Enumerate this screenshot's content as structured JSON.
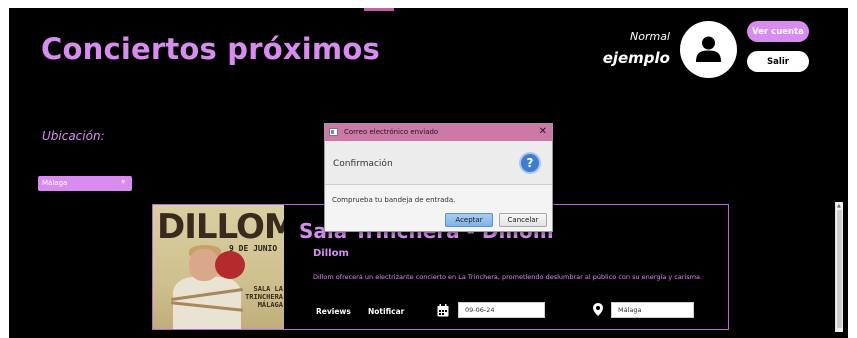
{
  "header": {
    "title": "Conciertos próximos",
    "user_role": "Normal",
    "user_name": "ejemplo",
    "account_button": "Ver cuenta",
    "logout_button": "Salir"
  },
  "filters": {
    "location_label": "Ubicación:",
    "location_selected": "Málaga"
  },
  "event": {
    "title": "Sala Trinchera - Dillom",
    "artist": "Dillom",
    "description": "Dillom ofrecerá un electrizante concierto en La Trinchera, prometiendo deslumbrar al público con su energía y carisma.",
    "reviews_label": "Reviews",
    "notify_label": "Notificar",
    "date": "09-06-24",
    "venue_city": "Málaga",
    "poster": {
      "name": "DILLOM",
      "date_text": "9 DE JUNIO",
      "venue_lines": [
        "SALA LA",
        "TRINCHERA",
        "MÁLAGA"
      ]
    }
  },
  "dialog": {
    "window_title": "Correo electrónico enviado",
    "close_glyph": "✕",
    "header": "Confirmación",
    "message": "Comprueba tu bandeja de entrada.",
    "accept_label": "Aceptar",
    "cancel_label": "Cancelar"
  },
  "colors": {
    "accent": "#d98cf0",
    "background": "#000000",
    "dialog_titlebar": "#cd79a8",
    "question_icon": "#3d7cd1"
  },
  "icons": {
    "avatar": "user-icon",
    "calendar": "calendar-icon",
    "location": "location-pin-icon",
    "question": "question-icon",
    "dropdown": "chevron-down-icon"
  }
}
